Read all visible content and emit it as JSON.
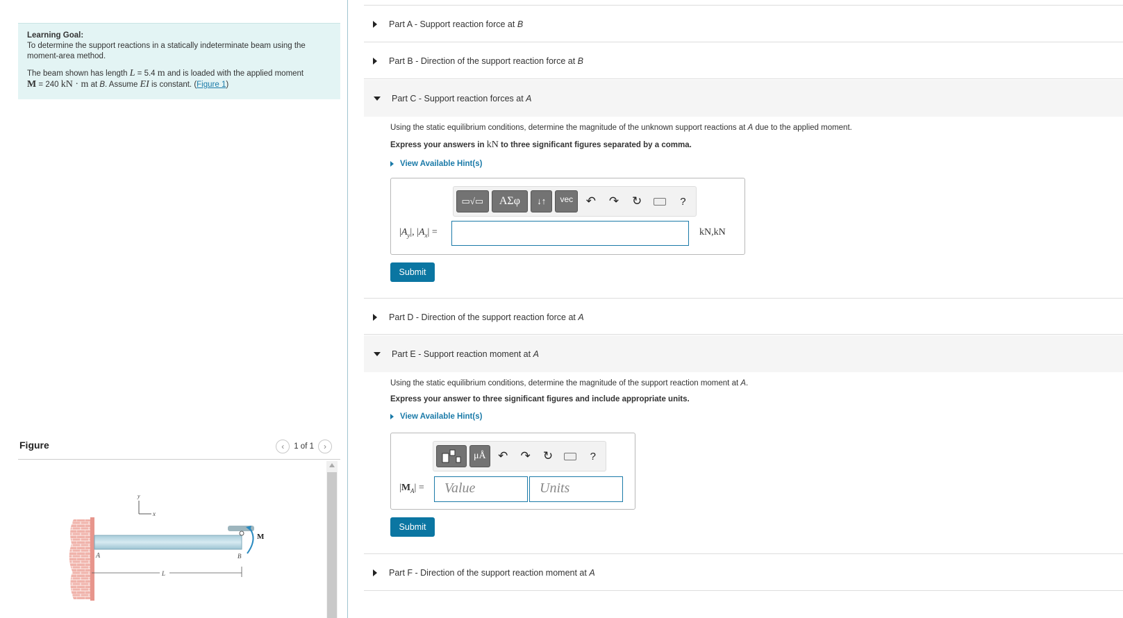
{
  "goal": {
    "title": "Learning Goal:",
    "text": "To determine the support reactions in a statically indeterminate beam using the moment-area method.",
    "desc_prefix": "The beam shown has length",
    "L_sym": "L",
    "L_value": " = 5.4 ",
    "L_unit": "m",
    "desc_mid": " and is loaded with the applied moment",
    "M_sym": "M",
    "M_value": " = 240 ",
    "M_unit": "kN · m",
    "desc_at": " at ",
    "B_sym": "B",
    "desc_assume": ". Assume ",
    "EI_sym": "EI",
    "desc_end": " is constant. (",
    "figure_link": "Figure 1",
    "desc_close": ")"
  },
  "figure": {
    "title": "Figure",
    "pager": "1 of 1",
    "labels": {
      "A": "A",
      "B": "B",
      "M": "M",
      "L": "L",
      "x": "x",
      "y": "y"
    }
  },
  "parts": [
    {
      "prefix": "Part A",
      "sep": " - ",
      "title": "Support reaction force at ",
      "point": "B"
    },
    {
      "prefix": "Part B",
      "sep": " - ",
      "title": "Direction of the support reaction force at ",
      "point": "B"
    },
    {
      "prefix": "Part C",
      "sep": " - ",
      "title": "Support reaction forces at ",
      "point": "A"
    },
    {
      "prefix": "Part D",
      "sep": " - ",
      "title": "Direction of the support reaction force at ",
      "point": "A"
    },
    {
      "prefix": "Part E",
      "sep": " - ",
      "title": "Support reaction moment at ",
      "point": "A"
    },
    {
      "prefix": "Part F",
      "sep": " - ",
      "title": "Direction of the support reaction moment at ",
      "point": "A"
    }
  ],
  "partC": {
    "question_pre": "Using the static equilibrium conditions, determine the magnitude of the unknown support reactions at ",
    "question_point": "A",
    "question_post": " due to the applied moment.",
    "instruction_pre": "Express your answers in ",
    "instruction_unit": "kN",
    "instruction_post": " to three significant figures separated by a comma.",
    "hint": "View Available Hint(s)",
    "toolbar": {
      "templates": "▭√▭",
      "greek": "ΑΣφ",
      "arrows": "↓↑",
      "vec": "vec",
      "help": "?"
    },
    "eq_label": "|Ay|, |Ax| =",
    "eq_Ay": "A",
    "eq_y": "y",
    "eq_Ax": "A",
    "eq_x": "x",
    "unit": "kN,kN",
    "submit": "Submit"
  },
  "partE": {
    "question_pre": "Using the static equilibrium conditions, determine the magnitude of the support reaction moment at ",
    "question_point": "A",
    "question_post": ".",
    "instruction": "Express your answer to three significant figures and include appropriate units.",
    "hint": "View Available Hint(s)",
    "toolbar": {
      "units": "μÅ",
      "help": "?"
    },
    "eq_M": "M",
    "eq_A": "A",
    "value_placeholder": "Value",
    "units_placeholder": "Units",
    "submit": "Submit"
  },
  "colors": {
    "accent": "#0b76a2",
    "goal_bg": "#e3f4f4",
    "beam": "#bcd9e4",
    "wall": "#e9a7a0"
  }
}
